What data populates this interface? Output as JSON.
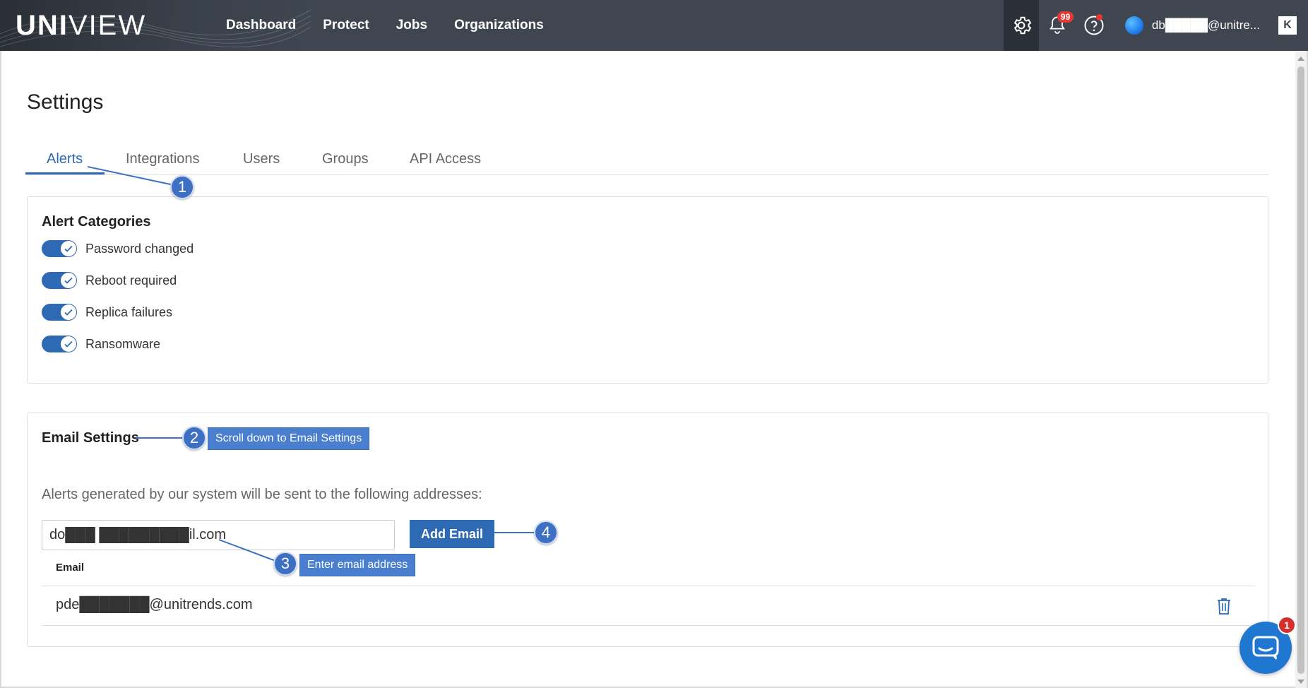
{
  "header": {
    "logo_bold": "UNI",
    "logo_light": "VIEW",
    "nav": [
      "Dashboard",
      "Protect",
      "Jobs",
      "Organizations"
    ],
    "notifications_badge": "99",
    "user_name": "db█████@unitre...",
    "k_label": "K"
  },
  "page": {
    "title": "Settings"
  },
  "tabs": [
    "Alerts",
    "Integrations",
    "Users",
    "Groups",
    "API Access"
  ],
  "alert_categories": {
    "title": "Alert Categories",
    "items": [
      {
        "label": "Password changed",
        "enabled": true
      },
      {
        "label": "Reboot required",
        "enabled": true
      },
      {
        "label": "Replica failures",
        "enabled": true
      },
      {
        "label": "Ransomware",
        "enabled": true
      }
    ]
  },
  "email_settings": {
    "title": "Email Settings",
    "description": "Alerts generated by our system will be sent to the following addresses:",
    "input_value": "do███ █████████il.com",
    "add_button": "Add Email",
    "column_header": "Email",
    "rows": [
      {
        "email": "pde███████@unitrends.com"
      }
    ]
  },
  "annotations": [
    {
      "number": "1",
      "label": ""
    },
    {
      "number": "2",
      "label": "Scroll down to Email Settings"
    },
    {
      "number": "3",
      "label": "Enter email address"
    },
    {
      "number": "4",
      "label": ""
    }
  ],
  "chat": {
    "badge": "1"
  },
  "colors": {
    "topbar": "#3f4650",
    "accent": "#2e6ab3",
    "annotation": "#3d6fc2",
    "alert_red": "#e53935"
  }
}
